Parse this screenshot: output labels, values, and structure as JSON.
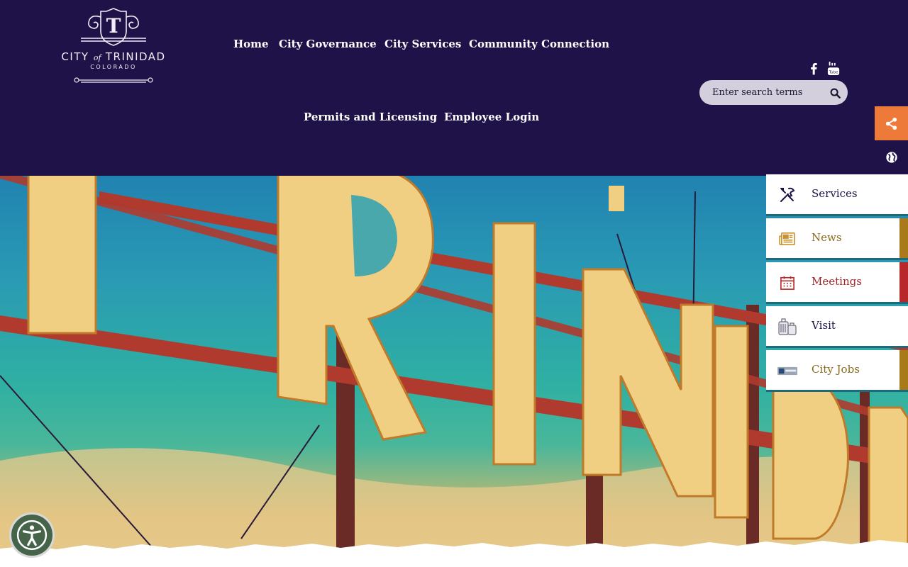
{
  "brand": {
    "logo_letter": "T",
    "logo_city_prefix": "CITY",
    "logo_city_of": "of",
    "logo_city_name": "TRINIDAD",
    "logo_state": "COLORADO"
  },
  "nav": {
    "items": [
      {
        "label": "Home"
      },
      {
        "label": "City Governance"
      },
      {
        "label": "City Services"
      },
      {
        "label": "Community Connection"
      },
      {
        "label": "Permits and Licensing"
      },
      {
        "label": "Employee Login"
      }
    ]
  },
  "social": {
    "facebook_icon": "facebook-icon",
    "youtube_icon": "youtube-icon"
  },
  "search": {
    "placeholder": "Enter search terms",
    "button_icon": "search-icon"
  },
  "side_tabs": {
    "share_icon": "share-icon",
    "translate_icon": "globe-icon"
  },
  "quick_links": [
    {
      "label": "Services",
      "icon": "tools-icon",
      "text_color": "#1e1248",
      "strip_color": "#ffffff"
    },
    {
      "label": "News",
      "icon": "newspaper-icon",
      "text_color": "#8a6a1e",
      "strip_color": "#a87a1a"
    },
    {
      "label": "Meetings",
      "icon": "calendar-icon",
      "text_color": "#a0282a",
      "strip_color": "#b8282a"
    },
    {
      "label": "Visit",
      "icon": "luggage-icon",
      "text_color": "#1e1248",
      "strip_color": "#1e1248"
    },
    {
      "label": "City Jobs",
      "icon": "jobs-icon",
      "text_color": "#8a6a1e",
      "strip_color": "#a87a1a"
    }
  ],
  "hero": {
    "letters": [
      "I",
      "R",
      "I",
      "N",
      "I",
      "D",
      "A"
    ]
  },
  "accessibility": {
    "icon": "accessibility-icon"
  },
  "colors": {
    "header_bg": "#1e1248",
    "share_accent": "#ee7a3a",
    "teal_rule": "#1f6a7a"
  }
}
